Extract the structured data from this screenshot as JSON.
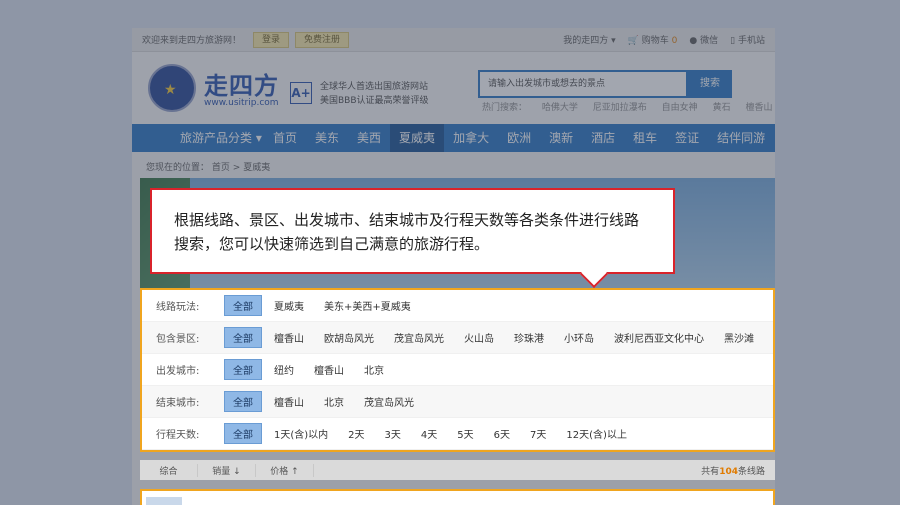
{
  "topbar": {
    "welcome": "欢迎来到走四方旅游网！",
    "login": "登录",
    "register": "免费注册",
    "my_account": "我的走四方",
    "cart_label": "购物车",
    "cart_count": "0",
    "wechat": "微信",
    "mobile": "手机站"
  },
  "header": {
    "logo_text": "走四方",
    "logo_url": "www.usitrip.com",
    "aplus": "A+",
    "slogan_line1": "全球华人首选出国旅游网站",
    "slogan_line2": "美国BBB认证最高荣誉评级",
    "search_placeholder": "请输入出发城市或想去的景点",
    "search_button": "搜索",
    "hot_label": "热门搜索：",
    "hot_items": [
      "哈佛大学",
      "尼亚加拉瀑布",
      "自由女神",
      "黄石",
      "檀香山"
    ]
  },
  "nav": {
    "category": "旅游产品分类",
    "items": [
      "首页",
      "美东",
      "美西",
      "夏威夷",
      "加拿大",
      "欧洲",
      "澳新",
      "酒店",
      "租车",
      "签证",
      "结伴同游"
    ]
  },
  "breadcrumb": {
    "prefix": "您现在的位置：",
    "home": "首页",
    "sep": ">",
    "current": "夏威夷"
  },
  "callout": {
    "text": "根据线路、景区、出发城市、结束城市及行程天数等各类条件进行线路搜索，您可以快速筛选到自己满意的旅游行程。"
  },
  "filters": [
    {
      "label": "线路玩法:",
      "options": [
        "全部",
        "夏威夷",
        "美东+美西+夏威夷"
      ]
    },
    {
      "label": "包含景区:",
      "options": [
        "全部",
        "檀香山",
        "欧胡岛风光",
        "茂宜岛风光",
        "火山岛",
        "珍珠港",
        "小环岛",
        "波利尼西亚文化中心",
        "黑沙滩"
      ]
    },
    {
      "label": "出发城市:",
      "options": [
        "全部",
        "纽约",
        "檀香山",
        "北京"
      ]
    },
    {
      "label": "结束城市:",
      "options": [
        "全部",
        "檀香山",
        "北京",
        "茂宜岛风光"
      ]
    },
    {
      "label": "行程天数:",
      "options": [
        "全部",
        "1天(含)以内",
        "2天",
        "3天",
        "4天",
        "5天",
        "6天",
        "7天",
        "12天(含)以上"
      ]
    }
  ],
  "sortbar": {
    "items": [
      "综合",
      "销量 ↓",
      "价格 ↑"
    ],
    "total_prefix": "共有",
    "total_count": "104",
    "total_suffix": "条线路"
  }
}
